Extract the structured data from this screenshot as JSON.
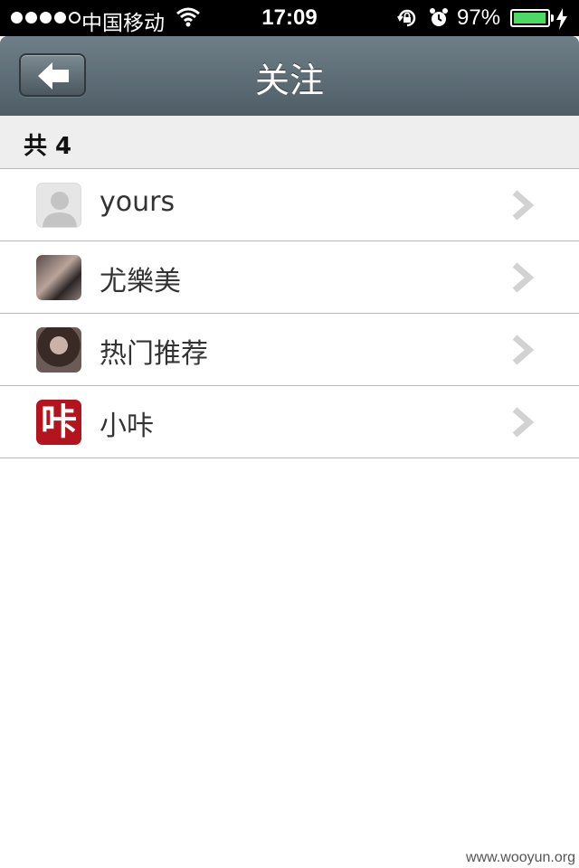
{
  "status_bar": {
    "carrier": "中国移动",
    "time": "17:09",
    "battery_percent": "97%",
    "battery_level": 0.97,
    "icons": [
      "signal-dots-icon",
      "wifi-icon",
      "rotation-lock-icon",
      "alarm-icon",
      "battery-icon",
      "charging-bolt-icon"
    ]
  },
  "nav": {
    "title": "关注",
    "back_icon": "arrow-left-icon"
  },
  "count_header": {
    "label": "共 4"
  },
  "follow_list": [
    {
      "name": "yours",
      "avatar": "default-user-avatar"
    },
    {
      "name": "尤樂美",
      "avatar": "user-photo-avatar"
    },
    {
      "name": "热门推荐",
      "avatar": "user-photo-avatar"
    },
    {
      "name": "小咔",
      "avatar": "brand-avatar",
      "avatar_text": "咔",
      "avatar_color": "#b3141e"
    }
  ],
  "watermark": "www.wooyun.org",
  "colors": {
    "navbar": "#5d6d76",
    "section_header": "#eeeeee",
    "battery_fill": "#4cd964"
  }
}
